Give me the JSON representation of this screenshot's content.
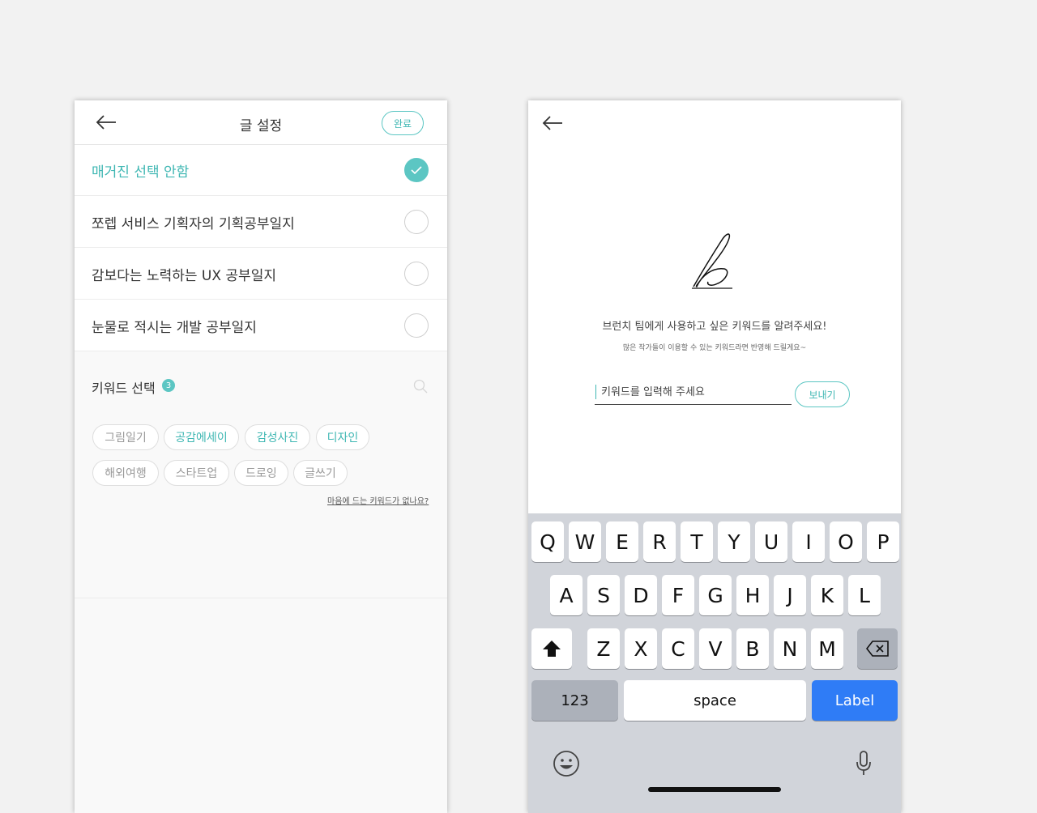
{
  "left": {
    "header": {
      "title": "글 설정",
      "done_label": "완료"
    },
    "magazines": [
      {
        "label": "매거진 선택 안함",
        "selected": true
      },
      {
        "label": "쪼렙 서비스 기획자의 기획공부일지",
        "selected": false
      },
      {
        "label": "감보다는 노력하는 UX 공부일지",
        "selected": false
      },
      {
        "label": "눈물로 적시는 개발 공부일지",
        "selected": false
      }
    ],
    "keywords": {
      "title": "키워드 선택",
      "count": "3",
      "chips": [
        {
          "label": "그림일기",
          "selected": false
        },
        {
          "label": "공감에세이",
          "selected": true
        },
        {
          "label": "감성사진",
          "selected": true
        },
        {
          "label": "디자인",
          "selected": true
        },
        {
          "label": "해외여행",
          "selected": false
        },
        {
          "label": "스타트업",
          "selected": false
        },
        {
          "label": "드로잉",
          "selected": false
        },
        {
          "label": "글쓰기",
          "selected": false
        }
      ],
      "no_keyword_link": "마음에 드는 키워드가 없나요?"
    }
  },
  "right": {
    "prompt_title": "브런치 팀에게 사용하고 싶은 키워드를 알려주세요!",
    "prompt_sub": "많은 작가들이 이용할 수 있는 키워드라면 반영해 드릴게요~",
    "input": {
      "placeholder": "키워드를 입력해 주세요",
      "value": ""
    },
    "send_label": "보내기",
    "keyboard": {
      "row1": [
        "Q",
        "W",
        "E",
        "R",
        "T",
        "Y",
        "U",
        "I",
        "O",
        "P"
      ],
      "row2": [
        "A",
        "S",
        "D",
        "F",
        "G",
        "H",
        "J",
        "K",
        "L"
      ],
      "row3": [
        "Z",
        "X",
        "C",
        "V",
        "B",
        "N",
        "M"
      ],
      "numbers_label": "123",
      "space_label": "space",
      "action_label": "Label"
    }
  },
  "colors": {
    "accent": "#5cc6c3",
    "keyboard_blue": "#2f7cf6",
    "keyboard_bg": "#d1d4da"
  }
}
